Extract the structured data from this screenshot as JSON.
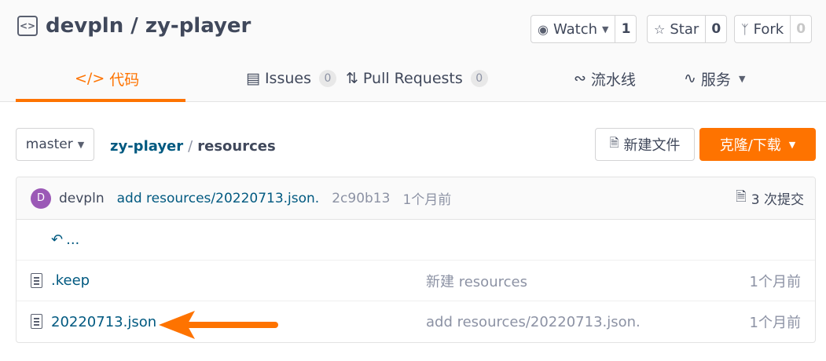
{
  "repo": {
    "owner": "devpln",
    "name": "zy-player",
    "title": "devpln / zy-player"
  },
  "actions": {
    "watch": {
      "label": "Watch",
      "count": "1"
    },
    "star": {
      "label": "Star",
      "count": "0"
    },
    "fork": {
      "label": "Fork",
      "count": "0"
    }
  },
  "tabs": [
    {
      "label": "代码",
      "active": true
    },
    {
      "label": "Issues",
      "count": "0"
    },
    {
      "label": "Pull Requests",
      "count": "0"
    },
    {
      "label": "流水线"
    },
    {
      "label": "服务"
    }
  ],
  "branch": {
    "name": "master"
  },
  "breadcrumb": {
    "repo": "zy-player",
    "separator": "/",
    "current": "resources"
  },
  "buttons": {
    "new_file": "新建文件",
    "clone": "克隆/下载"
  },
  "commit": {
    "avatar_letter": "D",
    "author": "devpln",
    "message": "add resources/20220713.json.",
    "hash": "2c90b13",
    "time": "1个月前",
    "count_label": "3 次提交"
  },
  "up_dir": {
    "label": "..."
  },
  "files": [
    {
      "name": ".keep",
      "commit": "新建 resources",
      "time": "1个月前"
    },
    {
      "name": "20220713.json",
      "commit": "add resources/20220713.json.",
      "time": "1个月前"
    }
  ],
  "colors": {
    "accent": "#fe7300",
    "link": "#005980",
    "muted": "#8c92a4",
    "avatar": "#9b59b6"
  }
}
